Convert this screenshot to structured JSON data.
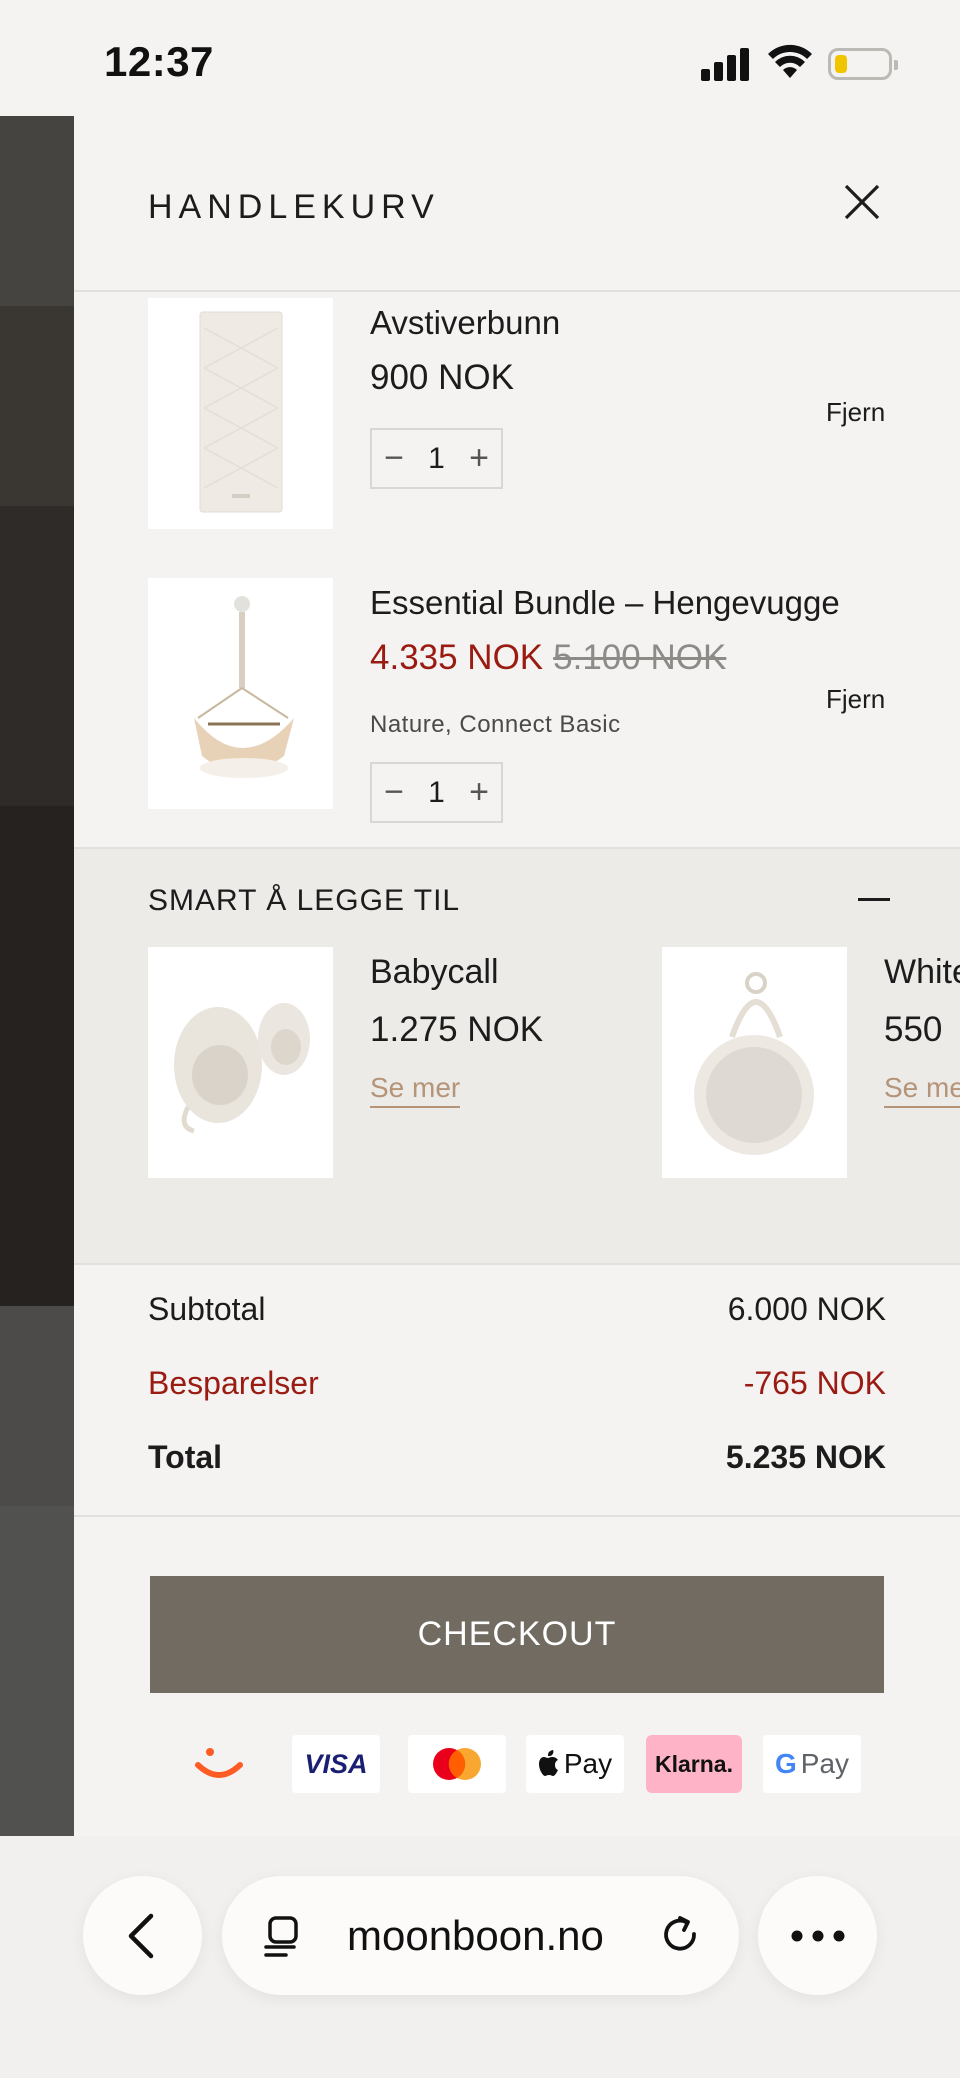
{
  "status_bar": {
    "time": "12:37"
  },
  "cart": {
    "title": "HANDLEKURV",
    "items": [
      {
        "name": "Avstiverbunn",
        "price": "900 NOK",
        "quantity": "1",
        "remove": "Fjern"
      },
      {
        "name": "Essential Bundle – Hengevugge",
        "sale_price": "4.335 NOK",
        "original_price": "5.100 NOK",
        "variant": "Nature, Connect Basic",
        "quantity": "1",
        "remove": "Fjern"
      }
    ],
    "qty_minus": "−",
    "qty_plus": "+"
  },
  "upsell": {
    "title": "SMART Å LEGGE TIL",
    "products": [
      {
        "name": "Babycall",
        "price": "1.275 NOK",
        "link": "Se mer"
      },
      {
        "name": "White",
        "price": "550",
        "link": "Se me"
      }
    ]
  },
  "totals": {
    "subtotal_label": "Subtotal",
    "subtotal_value": "6.000 NOK",
    "savings_label": "Besparelser",
    "savings_value": "-765 NOK",
    "total_label": "Total",
    "total_value": "5.235 NOK"
  },
  "checkout": {
    "label": "CHECKOUT"
  },
  "payment_methods": {
    "visa": "VISA",
    "applepay": "Pay",
    "klarna": "Klarna.",
    "gpay_g": "G",
    "gpay": "Pay"
  },
  "browser": {
    "url": "moonboon.no"
  },
  "colors": {
    "sale": "#9a1b12",
    "checkout_bg": "#716b61",
    "link_accent": "#b59478",
    "klarna_pink": "#ffb3c7",
    "vipps_orange": "#ff5b24"
  },
  "icons": [
    "close-icon",
    "minus-icon",
    "plus-icon",
    "collapse-icon",
    "back-icon",
    "tabs-icon",
    "reload-icon",
    "more-icon",
    "signal-icon",
    "wifi-icon",
    "battery-icon"
  ]
}
